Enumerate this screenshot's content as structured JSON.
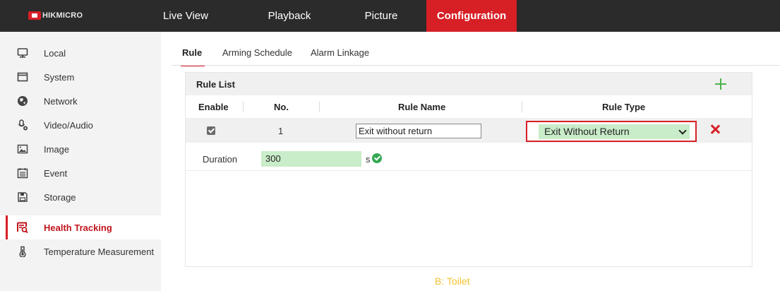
{
  "brand": {
    "logo_text": "HIKMICRO",
    "accent": "#d71f26"
  },
  "topnav": {
    "items": [
      {
        "label": "Live View"
      },
      {
        "label": "Playback"
      },
      {
        "label": "Picture"
      },
      {
        "label": "Configuration",
        "active": true
      }
    ]
  },
  "sidebar": {
    "items": [
      {
        "label": "Local",
        "icon": "monitor-icon"
      },
      {
        "label": "System",
        "icon": "window-icon"
      },
      {
        "label": "Network",
        "icon": "globe-icon"
      },
      {
        "label": "Video/Audio",
        "icon": "microphone-icon"
      },
      {
        "label": "Image",
        "icon": "image-icon"
      },
      {
        "label": "Event",
        "icon": "calendar-icon"
      },
      {
        "label": "Storage",
        "icon": "floppy-disk-icon"
      },
      {
        "label": "Health Tracking",
        "icon": "health-tracking-icon",
        "active": true
      },
      {
        "label": "Temperature Measurement",
        "icon": "thermometer-icon"
      }
    ]
  },
  "subtabs": {
    "items": [
      {
        "label": "Rule",
        "active": true
      },
      {
        "label": "Arming Schedule"
      },
      {
        "label": "Alarm Linkage"
      }
    ]
  },
  "rule_list": {
    "title": "Rule List",
    "columns": [
      "Enable",
      "No.",
      "Rule Name",
      "Rule Type"
    ],
    "rows": [
      {
        "enabled": true,
        "no": "1",
        "name": "Exit without return",
        "type": "Exit Without Return"
      }
    ],
    "duration": {
      "label": "Duration",
      "value": "300",
      "unit": "s"
    }
  },
  "caption": "B: Toilet",
  "colors": {
    "valid_field": "#c9ecc9",
    "success": "#34a853",
    "add": "#4bb34b",
    "caption": "#f2c230"
  }
}
